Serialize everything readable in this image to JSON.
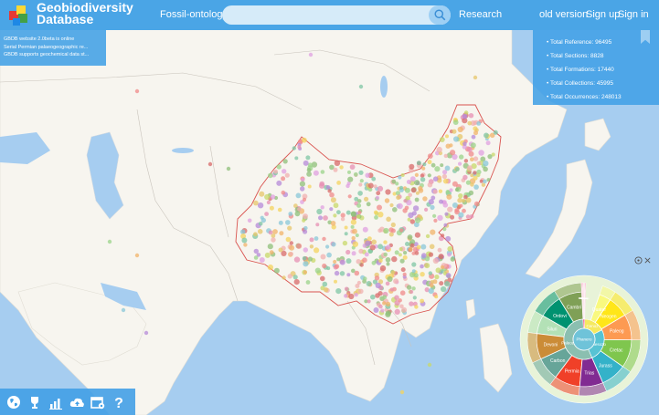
{
  "header": {
    "brand_line1": "Geobiodiversity",
    "brand_line2": "Database",
    "nav_fossil": "Fossil-ontology",
    "nav_research": "Research",
    "nav_old": "old version",
    "nav_signup": "Sign up",
    "nav_signin": "Sign in",
    "search_value": "",
    "logo_colors": [
      "#e53935",
      "#fdd835",
      "#43a047",
      "#1e88e5"
    ]
  },
  "news": [
    "GBDB website 2.0beta is online",
    "Serial Permian palaeogeographic re...",
    "GBDB supports geochemical data st..."
  ],
  "stats": [
    "Total Reference: 96495",
    "Total Sections: 8828",
    "Total Formations: 17440",
    "Total Collections: 45995",
    "Total Occurrences: 248013"
  ],
  "toolbar": [
    {
      "name": "globe-icon"
    },
    {
      "name": "trophy-icon"
    },
    {
      "name": "bar-chart-icon"
    },
    {
      "name": "cloud-upload-icon"
    },
    {
      "name": "calendar-settings-icon"
    },
    {
      "name": "help-icon"
    }
  ],
  "chronostrat": {
    "center_label": "Phanero",
    "eras": [
      {
        "label": "Paleozo",
        "color": "#8bbfb0"
      },
      {
        "label": "Mesozo",
        "color": "#57c3d4"
      },
      {
        "label": "Cenoz",
        "color": "#f5e960"
      }
    ],
    "periods": [
      {
        "label": "Cambri",
        "color": "#7fa056"
      },
      {
        "label": "Ordovi",
        "color": "#009270"
      },
      {
        "label": "Siluri",
        "color": "#b3e1b6"
      },
      {
        "label": "Devoni",
        "color": "#cb8c37"
      },
      {
        "label": "Carbon",
        "color": "#67a599"
      },
      {
        "label": "Permia",
        "color": "#f04028"
      },
      {
        "label": "Trias",
        "color": "#812b92"
      },
      {
        "label": "Jurass",
        "color": "#34b2c9"
      },
      {
        "label": "Cretac",
        "color": "#7fc64e"
      },
      {
        "label": "Paleog",
        "color": "#fd9a52"
      },
      {
        "label": "Neogen",
        "color": "#ffe619"
      },
      {
        "label": "Quater",
        "color": "#f9f97f"
      }
    ],
    "small_labels": [
      "Terren",
      "Archae",
      "Protero",
      "Ediaca",
      "Cryog",
      "Tonian",
      "Steni",
      "Ectas",
      "Calym",
      "Stathe",
      "Orosir",
      "Rhyac",
      "Siderian",
      "Neoar",
      "Mesoa",
      "Paleo",
      "Eoarc"
    ]
  },
  "map_labels": [],
  "colors": {
    "ocean": "#a6cdf0",
    "land": "#f7f5ef",
    "panel": "#42a0e6",
    "border": "#d9534f"
  }
}
